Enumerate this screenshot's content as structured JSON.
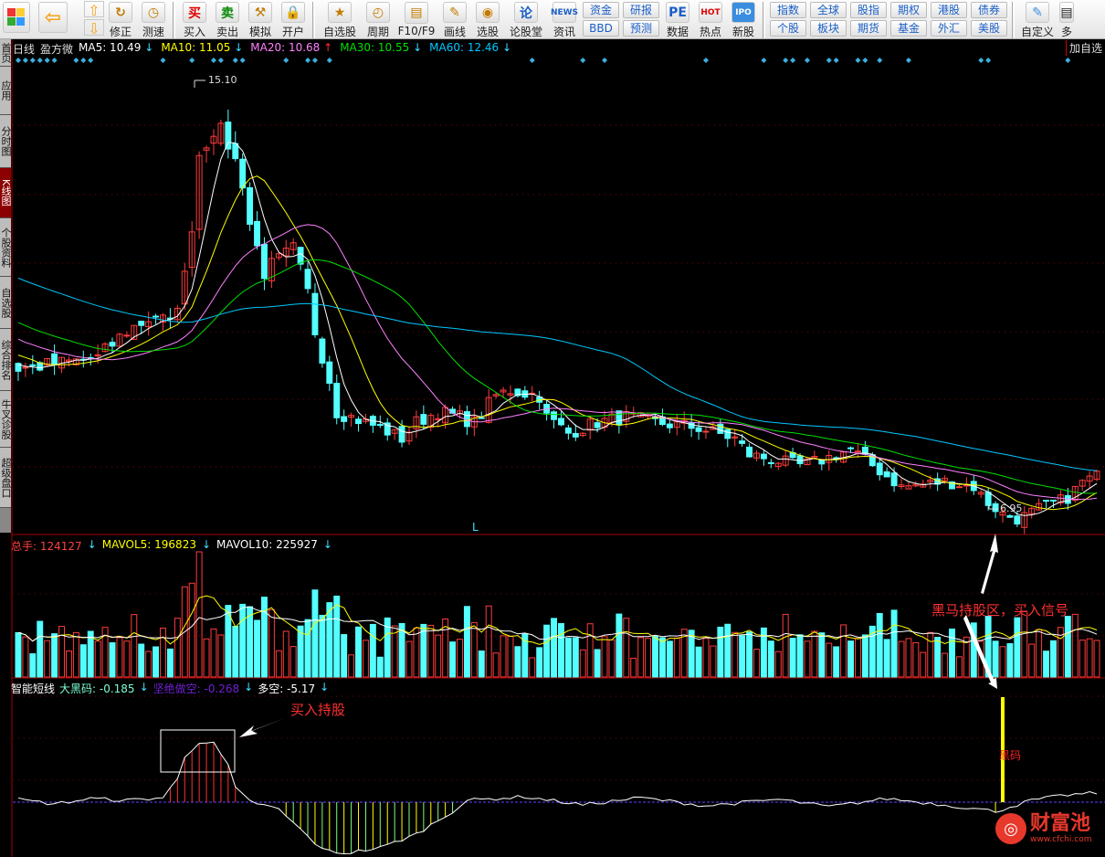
{
  "toolbar": {
    "items": [
      {
        "label": "修正",
        "icon": "refresh-icon"
      },
      {
        "label": "测速",
        "icon": "clock-icon"
      },
      {
        "label": "买入",
        "glyph": "买",
        "color": "#e00000"
      },
      {
        "label": "卖出",
        "glyph": "卖",
        "color": "#0a8a0a"
      },
      {
        "label": "模拟",
        "icon": "gavel-icon"
      },
      {
        "label": "开户",
        "icon": "lock-icon"
      },
      {
        "label": "自选股",
        "icon": "star-folder-icon"
      },
      {
        "label": "周期",
        "icon": "period-clock-icon"
      },
      {
        "label": "F10/F9",
        "icon": "f10-icon"
      },
      {
        "label": "画线",
        "icon": "pencil-icon"
      },
      {
        "label": "选股",
        "icon": "radar-icon"
      },
      {
        "label": "论股堂",
        "glyph": "论",
        "color": "#1b5fc6"
      },
      {
        "label": "资讯",
        "glyph": "NEWS",
        "color": "#1b5fc6"
      },
      {
        "label": "数据",
        "glyph": "PE",
        "color": "#1b5fc6"
      },
      {
        "label": "热点",
        "glyph": "HOT",
        "color": "#e00000"
      },
      {
        "label": "新股",
        "glyph": "IPO",
        "color": "#fff"
      }
    ],
    "pairs": [
      [
        "资金",
        "BBD"
      ],
      [
        "研报",
        "预测"
      ]
    ],
    "grid": [
      [
        "指数",
        "个股"
      ],
      [
        "全球",
        "板块"
      ],
      [
        "股指",
        "期货"
      ],
      [
        "期权",
        "基金"
      ],
      [
        "港股",
        "外汇"
      ],
      [
        "债券",
        "美股"
      ]
    ],
    "custom": "自定义",
    "more": "多"
  },
  "side_tabs": [
    "首页",
    "应用",
    "分时图",
    "K线图",
    "个股资料",
    "自选股",
    "综合排名",
    "牛叉诊股",
    "超级盘口"
  ],
  "active_tab": "K线图",
  "add_favorite": "加自选",
  "price_panel": {
    "period": "日线",
    "stock": "盈方微",
    "ma": [
      {
        "label": "MA5: 10.49",
        "arrow": "↓",
        "color": "#ffffff"
      },
      {
        "label": "MA10: 11.05",
        "arrow": "↓",
        "color": "#ffff00"
      },
      {
        "label": "MA20: 10.68",
        "arrow": "↑",
        "color": "#ff80ff"
      },
      {
        "label": "MA30: 10.55",
        "arrow": "↓",
        "color": "#00e000"
      },
      {
        "label": "MA60: 12.46",
        "arrow": "↓",
        "color": "#00c8ff"
      }
    ],
    "high_label": "15.10",
    "low_label": "6.95",
    "marker": "L"
  },
  "volume_panel": {
    "total": "总手: 124127",
    "mavol5": "MAVOL5: 196823",
    "mavol10": "MAVOL10: 225927",
    "arrow": "↓"
  },
  "indicator_panel": {
    "name": "智能短线",
    "dahei": "大黑码: -0.185",
    "jianjue": "坚绝做空: -0.268",
    "duokong": "多空: -5.17",
    "arrow": "↓",
    "bar_label": "黑码"
  },
  "annotations": {
    "buy_hold": "买入持股",
    "darkhorse": "黑马持股区，买入信号"
  },
  "watermark": {
    "brand": "财富池",
    "url": "www.cfchi.com"
  },
  "chart_data": {
    "type": "candlestick",
    "price_keypoints": [
      [
        -60,
        13.0
      ],
      [
        -30,
        11.6
      ],
      [
        0,
        9.8
      ],
      [
        6,
        9.9
      ],
      [
        11,
        10.0
      ],
      [
        15,
        10.5
      ],
      [
        19,
        10.8
      ],
      [
        21,
        10.6
      ],
      [
        23,
        11.5
      ],
      [
        24,
        12.5
      ],
      [
        25,
        13.8
      ],
      [
        27,
        14.3
      ],
      [
        29,
        14.0
      ],
      [
        31,
        13.3
      ],
      [
        32,
        12.5
      ],
      [
        34,
        11.6
      ],
      [
        36,
        11.8
      ],
      [
        38,
        12.0
      ],
      [
        40,
        11.2
      ],
      [
        41,
        10.5
      ],
      [
        43,
        9.6
      ],
      [
        44,
        9.0
      ],
      [
        46,
        8.9
      ],
      [
        50,
        8.7
      ],
      [
        53,
        8.5
      ],
      [
        55,
        8.8
      ],
      [
        58,
        9.0
      ],
      [
        61,
        8.9
      ],
      [
        63,
        8.8
      ],
      [
        66,
        9.3
      ],
      [
        68,
        9.4
      ],
      [
        72,
        9.3
      ],
      [
        73,
        8.9
      ],
      [
        74,
        8.8
      ],
      [
        76,
        8.6
      ],
      [
        80,
        8.8
      ],
      [
        84,
        8.9
      ],
      [
        88,
        8.8
      ],
      [
        94,
        8.7
      ],
      [
        99,
        8.5
      ],
      [
        101,
        8.2
      ],
      [
        108,
        8.0
      ],
      [
        111,
        8.1
      ],
      [
        115,
        8.3
      ],
      [
        118,
        8.0
      ],
      [
        122,
        7.6
      ],
      [
        128,
        7.7
      ],
      [
        132,
        7.6
      ],
      [
        134,
        7.3
      ],
      [
        136,
        7.1
      ],
      [
        138,
        7.0
      ],
      [
        141,
        7.2
      ],
      [
        145,
        7.4
      ],
      [
        147,
        7.7
      ],
      [
        149,
        7.8
      ]
    ],
    "candles": 150,
    "ylim": [
      6.75,
      15.6
    ],
    "high": 15.1,
    "low": 6.95,
    "ma_periods": [
      5,
      10,
      20,
      30,
      60
    ],
    "indicator_keypoints": [
      [
        0,
        0.3
      ],
      [
        5,
        -0.2
      ],
      [
        10,
        0.4
      ],
      [
        15,
        0.2
      ],
      [
        20,
        0.5
      ],
      [
        22,
        2.5
      ],
      [
        23,
        5
      ],
      [
        25,
        6.6
      ],
      [
        27,
        6.4
      ],
      [
        29,
        4
      ],
      [
        30,
        1.5
      ],
      [
        32,
        0.1
      ],
      [
        36,
        -0.8
      ],
      [
        39,
        -3
      ],
      [
        42,
        -5.2
      ],
      [
        45,
        -5.6
      ],
      [
        50,
        -5
      ],
      [
        55,
        -3.5
      ],
      [
        60,
        -1
      ],
      [
        62,
        0.2
      ],
      [
        70,
        0.6
      ],
      [
        78,
        -0.3
      ],
      [
        86,
        0.5
      ],
      [
        95,
        -0.4
      ],
      [
        105,
        0.3
      ],
      [
        112,
        -0.5
      ],
      [
        120,
        0.4
      ],
      [
        128,
        -0.3
      ],
      [
        135,
        -1.0
      ],
      [
        140,
        0.2
      ],
      [
        145,
        0.8
      ],
      [
        149,
        1.0
      ]
    ],
    "signal_index": 136
  }
}
